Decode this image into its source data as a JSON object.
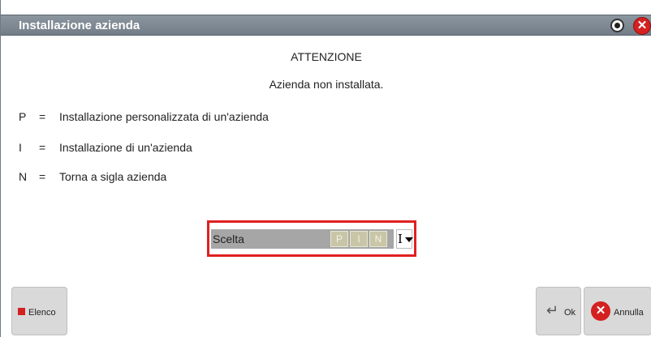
{
  "window": {
    "title": "Installazione azienda",
    "close_glyph": "✕"
  },
  "message": {
    "heading": "ATTENZIONE",
    "text": "Azienda non installata."
  },
  "options": [
    {
      "key": "P",
      "eq": "=",
      "description": "Installazione personalizzata di un'azienda"
    },
    {
      "key": "I",
      "eq": "=",
      "description": "Installazione di un'azienda"
    },
    {
      "key": "N",
      "eq": "=",
      "description": "Torna a sigla azienda"
    }
  ],
  "choice": {
    "label": "Scelta",
    "options": [
      "P",
      "I",
      "N"
    ],
    "value": "I"
  },
  "buttons": {
    "elenco": "Elenco",
    "ok": "Ok",
    "annulla": "Annulla",
    "ok_glyph": "↵",
    "annulla_glyph": "✕"
  },
  "colors": {
    "titlebar": "#7f8994",
    "accent_red": "#d42020",
    "highlight_border": "#e02020"
  },
  "icons": [
    "radio-icon",
    "close-icon",
    "enter-icon",
    "cancel-icon",
    "list-square-icon"
  ]
}
